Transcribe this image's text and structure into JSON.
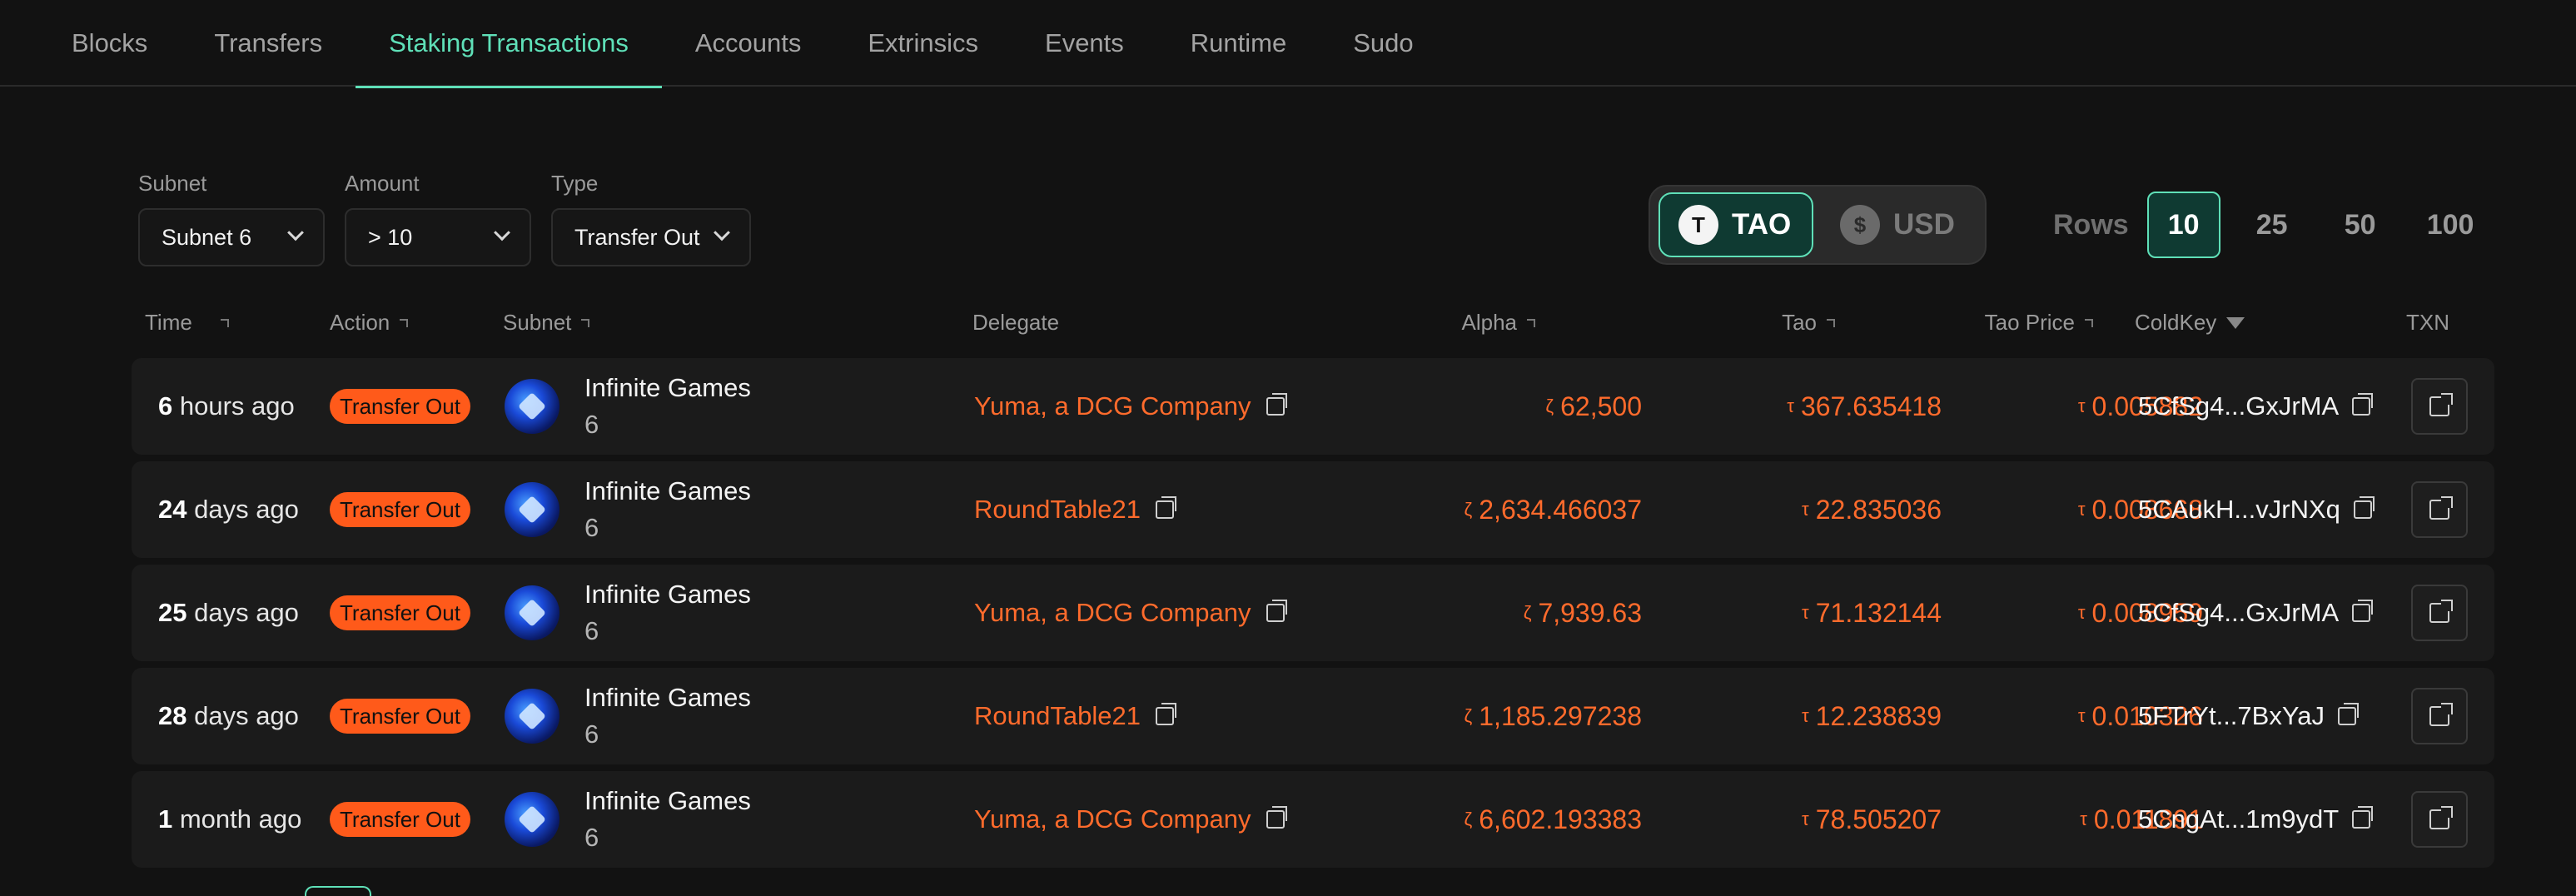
{
  "nav": {
    "tabs": [
      {
        "label": "Blocks"
      },
      {
        "label": "Transfers"
      },
      {
        "label": "Staking Transactions"
      },
      {
        "label": "Accounts"
      },
      {
        "label": "Extrinsics"
      },
      {
        "label": "Events"
      },
      {
        "label": "Runtime"
      },
      {
        "label": "Sudo"
      }
    ],
    "active": "Staking Transactions"
  },
  "filters": {
    "subnet": {
      "label": "Subnet",
      "value": "Subnet 6"
    },
    "amount": {
      "label": "Amount",
      "value": "> 10"
    },
    "type": {
      "label": "Type",
      "value": "Transfer Out"
    }
  },
  "currency": {
    "tao": {
      "icon": "T",
      "label": "TAO"
    },
    "usd": {
      "icon": "$",
      "label": "USD"
    },
    "selected": "TAO"
  },
  "rows_selector": {
    "label": "Rows",
    "options": [
      "10",
      "25",
      "50",
      "100"
    ],
    "selected": "10"
  },
  "table": {
    "headers": {
      "time": "Time",
      "action": "Action",
      "subnet": "Subnet",
      "delegate": "Delegate",
      "alpha": "Alpha",
      "tao": "Tao",
      "tao_price": "Tao Price",
      "coldkey": "ColdKey",
      "txn": "TXN"
    },
    "alpha_symbol": "ζ",
    "tao_symbol": "τ",
    "rows": [
      {
        "time_num": "6",
        "time_unit": " hours ago",
        "action": "Transfer Out",
        "subnet_name": "Infinite Games",
        "subnet_id": "6",
        "delegate": "Yuma, a DCG Company",
        "alpha": "62,500",
        "tao": "367.635418",
        "price": "0.005882",
        "coldkey": "5CfSg4...GxJrMA"
      },
      {
        "time_num": "24",
        "time_unit": " days ago",
        "action": "Transfer Out",
        "subnet_name": "Infinite Games",
        "subnet_id": "6",
        "delegate": "RoundTable21",
        "alpha": "2,634.466037",
        "tao": "22.835036",
        "price": "0.008668",
        "coldkey": "5CAukH...vJrNXq"
      },
      {
        "time_num": "25",
        "time_unit": " days ago",
        "action": "Transfer Out",
        "subnet_name": "Infinite Games",
        "subnet_id": "6",
        "delegate": "Yuma, a DCG Company",
        "alpha": "7,939.63",
        "tao": "71.132144",
        "price": "0.008959",
        "coldkey": "5CfSg4...GxJrMA"
      },
      {
        "time_num": "28",
        "time_unit": " days ago",
        "action": "Transfer Out",
        "subnet_name": "Infinite Games",
        "subnet_id": "6",
        "delegate": "RoundTable21",
        "alpha": "1,185.297238",
        "tao": "12.238839",
        "price": "0.010326",
        "coldkey": "5FTrYt...7BxYaJ"
      },
      {
        "time_num": "1",
        "time_unit": " month ago",
        "action": "Transfer Out",
        "subnet_name": "Infinite Games",
        "subnet_id": "6",
        "delegate": "Yuma, a DCG Company",
        "alpha": "6,602.193383",
        "tao": "78.505207",
        "price": "0.011891",
        "coldkey": "5CngAt...1m9ydT"
      }
    ]
  },
  "colors": {
    "accent": "#5fe0b8",
    "negative": "#ff6b2c",
    "badge": "#ff5a1a",
    "background": "#121212",
    "row": "#1b1b1b"
  }
}
